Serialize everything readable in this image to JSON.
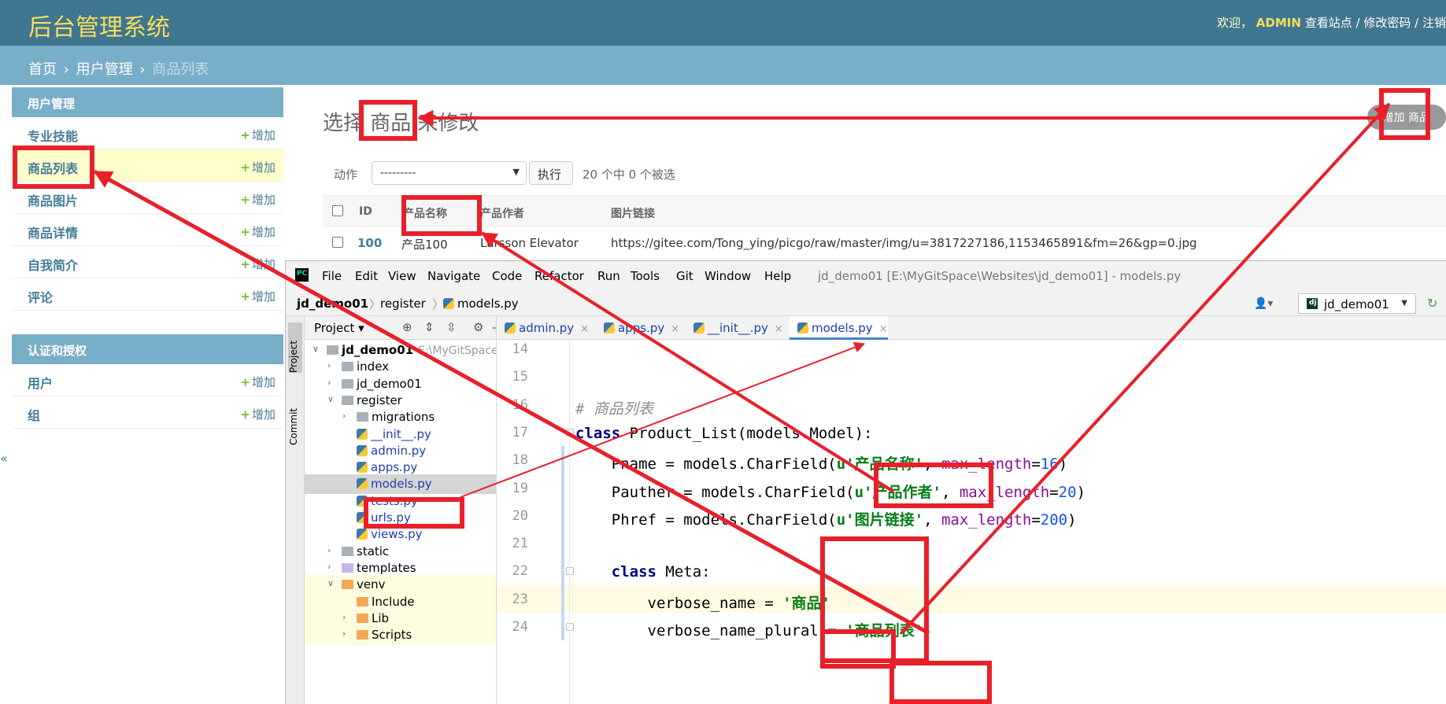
{
  "admin": {
    "brand": "后台管理系统",
    "user_tools": {
      "welcome": "欢迎，",
      "username": "ADMIN",
      "view_site": "查看站点",
      "sep": "/",
      "change_password": "修改密码",
      "logout": "注销"
    },
    "breadcrumb": {
      "home": "首页",
      "app": "用户管理",
      "current": "商品列表",
      "sep": "›"
    },
    "sidebar": [
      {
        "caption": "用户管理",
        "items": [
          {
            "label": "专业技能",
            "add": "增加"
          },
          {
            "label": "商品列表",
            "add": "增加",
            "selected": true
          },
          {
            "label": "商品图片",
            "add": "增加"
          },
          {
            "label": "商品详情",
            "add": "增加"
          },
          {
            "label": "自我简介",
            "add": "增加"
          },
          {
            "label": "评论",
            "add": "增加"
          }
        ]
      },
      {
        "caption": "认证和授权",
        "items": [
          {
            "label": "用户",
            "add": "增加"
          },
          {
            "label": "组",
            "add": "增加"
          }
        ]
      }
    ],
    "sidebar_toggle": "«",
    "plus": "+",
    "page_title": "选择 商品 来修改",
    "add_button": "增加 商品",
    "action_label": "动作",
    "action_select_value": "---------",
    "go_button": "执行",
    "selection_count": "20 个中 0 个被选",
    "columns": [
      "ID",
      "产品名称",
      "产品作者",
      "图片链接"
    ],
    "rows": [
      {
        "id": "100",
        "name": "产品100",
        "author": "Larsson Elevator",
        "href": "https://gitee.com/Tong_ying/picgo/raw/master/img/u=3817227186,1153465891&fm=26&gp=0.jpg"
      }
    ]
  },
  "ide": {
    "logo": "PC",
    "menu": [
      "File",
      "Edit",
      "View",
      "Navigate",
      "Code",
      "Refactor",
      "Run",
      "Tools",
      "Git",
      "Window",
      "Help"
    ],
    "title": "jd_demo01 [E:\\MyGitSpace\\Websites\\jd_demo01] - models.py",
    "nav": [
      "jd_demo01",
      "register",
      "models.py"
    ],
    "nav_sep": "〉",
    "run_config": "jd_demo01",
    "side_tabs": [
      "Project",
      "Commit"
    ],
    "project_label": "Project",
    "tree": [
      {
        "label": "jd_demo01",
        "extra": "E:\\MyGitSpace\\Web",
        "depth": 0,
        "kind": "root"
      },
      {
        "label": "index",
        "depth": 1,
        "kind": "folder"
      },
      {
        "label": "jd_demo01",
        "depth": 1,
        "kind": "folder"
      },
      {
        "label": "register",
        "depth": 1,
        "kind": "folder-open"
      },
      {
        "label": "migrations",
        "depth": 2,
        "kind": "folder"
      },
      {
        "label": "__init__.py",
        "depth": 2,
        "kind": "py"
      },
      {
        "label": "admin.py",
        "depth": 2,
        "kind": "py"
      },
      {
        "label": "apps.py",
        "depth": 2,
        "kind": "py"
      },
      {
        "label": "models.py",
        "depth": 2,
        "kind": "py",
        "selected": true
      },
      {
        "label": "tests.py",
        "depth": 2,
        "kind": "py"
      },
      {
        "label": "urls.py",
        "depth": 2,
        "kind": "py"
      },
      {
        "label": "views.py",
        "depth": 2,
        "kind": "py"
      },
      {
        "label": "static",
        "depth": 1,
        "kind": "folder"
      },
      {
        "label": "templates",
        "depth": 1,
        "kind": "folder-purple"
      },
      {
        "label": "venv",
        "depth": 1,
        "kind": "folder-orange-open"
      },
      {
        "label": "Include",
        "depth": 2,
        "kind": "folder-orange"
      },
      {
        "label": "Lib",
        "depth": 2,
        "kind": "folder-orange"
      },
      {
        "label": "Scripts",
        "depth": 2,
        "kind": "folder-orange"
      }
    ],
    "tabs": [
      {
        "label": "admin.py"
      },
      {
        "label": "apps.py"
      },
      {
        "label": "__init__.py"
      },
      {
        "label": "models.py",
        "active": true
      }
    ],
    "tab_close": "×",
    "code": [
      {
        "ln": "14"
      },
      {
        "ln": "15"
      },
      {
        "ln": "16",
        "comment": "# 商品列表"
      },
      {
        "ln": "17",
        "kw": "class",
        "rest": " Product_List(models.Model):"
      },
      {
        "ln": "18",
        "pre": "    Pname = models.CharField(",
        "str": "u'产品名称'",
        "mid": ", ",
        "kwarg": "max_length",
        "eq": "=",
        "num": "16",
        "post": ")"
      },
      {
        "ln": "19",
        "pre": "    Pauther = models.CharField(",
        "str": "u'产品作者'",
        "mid": ", ",
        "kwarg": "max_length",
        "eq": "=",
        "num": "20",
        "post": ")"
      },
      {
        "ln": "20",
        "pre": "    Phref = models.CharField(",
        "str": "u'图片链接'",
        "mid": ", ",
        "kwarg": "max_length",
        "eq": "=",
        "num": "200",
        "post": ")"
      },
      {
        "ln": "21"
      },
      {
        "ln": "22",
        "kw": "class",
        "rest": " Meta:",
        "indent": "    "
      },
      {
        "ln": "23",
        "pre": "        verbose_name = ",
        "str": "'商品'"
      },
      {
        "ln": "24",
        "pre": "        verbose_name_plural = ",
        "str": "'商品列表'"
      }
    ]
  },
  "annotation_color": "#e8202a"
}
